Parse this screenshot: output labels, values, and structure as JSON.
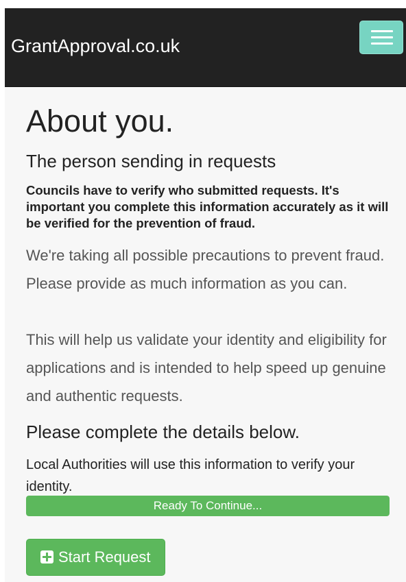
{
  "navbar": {
    "brand": "GrantApproval.co.uk",
    "menu_icon": "hamburger-menu-icon",
    "background_color": "#222222",
    "toggle_color": "#77d4c2"
  },
  "main": {
    "title": "About you.",
    "subtitle": "The person sending in requests",
    "verification_notice": "Councils have to verify who submitted requests. It's important you complete this information accurately as it will be verified for the prevention of fraud.",
    "paragraph_1": "We're taking all possible precautions to prevent fraud. Please provide as much information as you can.",
    "paragraph_2": "This will help us validate your identity and eligibility for applications and is intended to help speed up genuine and authentic requests.",
    "details_heading": "Please complete the details below.",
    "details_note": "Local Authorities will use this information to verify your identity.",
    "progress": {
      "label": "Ready To Continue...",
      "percent": 100,
      "color": "#5cb85c"
    },
    "start_button": {
      "label": "Start Request",
      "icon": "plus-square-icon",
      "color": "#5cb85c"
    }
  }
}
